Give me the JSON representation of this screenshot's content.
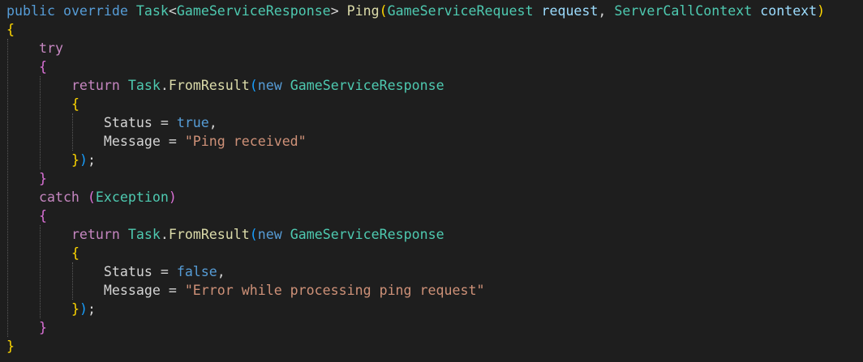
{
  "colors": {
    "background": "#1e1e1e",
    "default": "#d4d4d4",
    "keyword": "#569cd6",
    "control": "#c586c0",
    "type": "#4ec9b0",
    "method": "#dcdcaa",
    "param": "#9cdcfe",
    "string": "#ce9178",
    "punct": "#d4d4d4",
    "bracket1": "#ffd700",
    "bracket2": "#da70d6",
    "bracket3": "#179fff"
  },
  "code": {
    "lines": [
      {
        "indent": 0,
        "tokens": [
          {
            "t": "public",
            "c": "keyword"
          },
          {
            "t": " ",
            "c": "punct"
          },
          {
            "t": "override",
            "c": "keyword"
          },
          {
            "t": " ",
            "c": "punct"
          },
          {
            "t": "Task",
            "c": "type"
          },
          {
            "t": "<",
            "c": "punct"
          },
          {
            "t": "GameServiceResponse",
            "c": "type"
          },
          {
            "t": "> ",
            "c": "punct"
          },
          {
            "t": "Ping",
            "c": "method"
          },
          {
            "t": "(",
            "c": "bracket1"
          },
          {
            "t": "GameServiceRequest",
            "c": "type"
          },
          {
            "t": " ",
            "c": "punct"
          },
          {
            "t": "request",
            "c": "param"
          },
          {
            "t": ", ",
            "c": "punct"
          },
          {
            "t": "ServerCallContext",
            "c": "type"
          },
          {
            "t": " ",
            "c": "punct"
          },
          {
            "t": "context",
            "c": "param"
          },
          {
            "t": ")",
            "c": "bracket1"
          }
        ]
      },
      {
        "indent": 0,
        "tokens": [
          {
            "t": "{",
            "c": "bracket1"
          }
        ]
      },
      {
        "indent": 1,
        "tokens": [
          {
            "t": "try",
            "c": "control"
          }
        ]
      },
      {
        "indent": 1,
        "tokens": [
          {
            "t": "{",
            "c": "bracket2"
          }
        ]
      },
      {
        "indent": 2,
        "tokens": [
          {
            "t": "return",
            "c": "control"
          },
          {
            "t": " ",
            "c": "punct"
          },
          {
            "t": "Task",
            "c": "type"
          },
          {
            "t": ".",
            "c": "punct"
          },
          {
            "t": "FromResult",
            "c": "method"
          },
          {
            "t": "(",
            "c": "bracket3"
          },
          {
            "t": "new",
            "c": "keyword"
          },
          {
            "t": " ",
            "c": "punct"
          },
          {
            "t": "GameServiceResponse",
            "c": "type"
          }
        ]
      },
      {
        "indent": 2,
        "tokens": [
          {
            "t": "{",
            "c": "bracket1"
          }
        ]
      },
      {
        "indent": 3,
        "tokens": [
          {
            "t": "Status",
            "c": "default"
          },
          {
            "t": " = ",
            "c": "punct"
          },
          {
            "t": "true",
            "c": "keyword"
          },
          {
            "t": ",",
            "c": "punct"
          }
        ]
      },
      {
        "indent": 3,
        "tokens": [
          {
            "t": "Message",
            "c": "default"
          },
          {
            "t": " = ",
            "c": "punct"
          },
          {
            "t": "\"Ping received\"",
            "c": "string"
          }
        ]
      },
      {
        "indent": 2,
        "tokens": [
          {
            "t": "}",
            "c": "bracket1"
          },
          {
            "t": ")",
            "c": "bracket3"
          },
          {
            "t": ";",
            "c": "punct"
          }
        ]
      },
      {
        "indent": 1,
        "tokens": [
          {
            "t": "}",
            "c": "bracket2"
          }
        ]
      },
      {
        "indent": 1,
        "tokens": [
          {
            "t": "catch",
            "c": "control"
          },
          {
            "t": " ",
            "c": "punct"
          },
          {
            "t": "(",
            "c": "bracket2"
          },
          {
            "t": "Exception",
            "c": "type"
          },
          {
            "t": ")",
            "c": "bracket2"
          }
        ]
      },
      {
        "indent": 1,
        "tokens": [
          {
            "t": "{",
            "c": "bracket2"
          }
        ]
      },
      {
        "indent": 2,
        "tokens": [
          {
            "t": "return",
            "c": "control"
          },
          {
            "t": " ",
            "c": "punct"
          },
          {
            "t": "Task",
            "c": "type"
          },
          {
            "t": ".",
            "c": "punct"
          },
          {
            "t": "FromResult",
            "c": "method"
          },
          {
            "t": "(",
            "c": "bracket3"
          },
          {
            "t": "new",
            "c": "keyword"
          },
          {
            "t": " ",
            "c": "punct"
          },
          {
            "t": "GameServiceResponse",
            "c": "type"
          }
        ]
      },
      {
        "indent": 2,
        "tokens": [
          {
            "t": "{",
            "c": "bracket1"
          }
        ]
      },
      {
        "indent": 3,
        "tokens": [
          {
            "t": "Status",
            "c": "default"
          },
          {
            "t": " = ",
            "c": "punct"
          },
          {
            "t": "false",
            "c": "keyword"
          },
          {
            "t": ",",
            "c": "punct"
          }
        ]
      },
      {
        "indent": 3,
        "tokens": [
          {
            "t": "Message",
            "c": "default"
          },
          {
            "t": " = ",
            "c": "punct"
          },
          {
            "t": "\"Error while processing ping request\"",
            "c": "string"
          }
        ]
      },
      {
        "indent": 2,
        "tokens": [
          {
            "t": "}",
            "c": "bracket1"
          },
          {
            "t": ")",
            "c": "bracket3"
          },
          {
            "t": ";",
            "c": "punct"
          }
        ]
      },
      {
        "indent": 1,
        "tokens": [
          {
            "t": "}",
            "c": "bracket2"
          }
        ]
      },
      {
        "indent": 0,
        "tokens": [
          {
            "t": "}",
            "c": "bracket1"
          }
        ]
      }
    ]
  }
}
